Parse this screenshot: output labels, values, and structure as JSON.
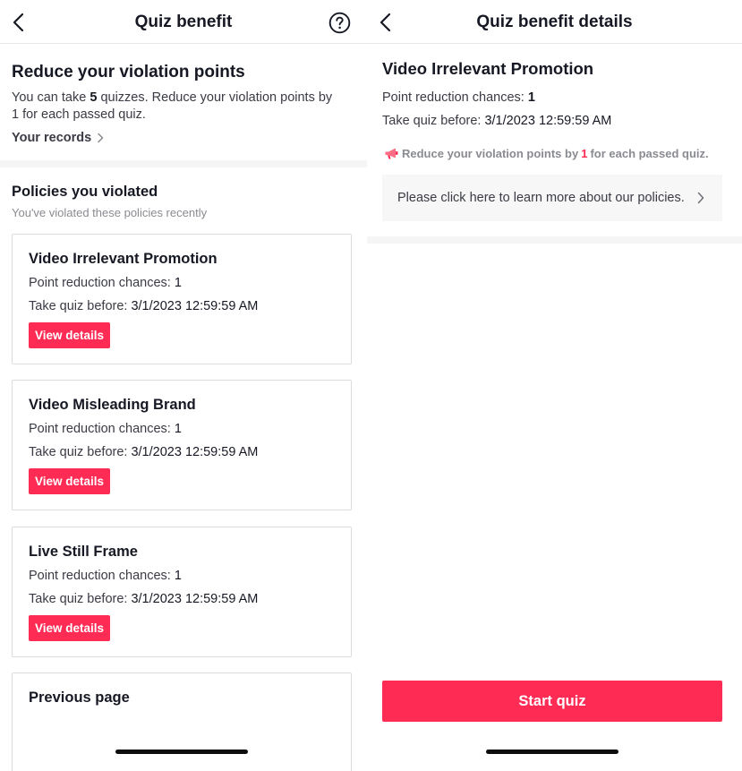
{
  "colors": {
    "accent": "#fe2c55",
    "text_primary": "#161823",
    "text_secondary": "#3a3b44",
    "text_muted": "#8a8b91"
  },
  "left": {
    "header": {
      "title": "Quiz benefit",
      "back_icon": "chevron-left-icon",
      "help_icon": "question-circle-icon"
    },
    "reduce": {
      "title": "Reduce your violation points",
      "desc_prefix": "You can take ",
      "quiz_count": "5",
      "desc_suffix": " quizzes. Reduce your violation points by 1 for each passed quiz.",
      "records_label": "Your records"
    },
    "policies": {
      "title": "Policies you violated",
      "subtitle": "You've violated these policies recently",
      "cards": [
        {
          "title": "Video Irrelevant Promotion",
          "chances_label": "Point reduction chances: ",
          "chances": "1",
          "deadline_label": "Take quiz before: ",
          "deadline": "3/1/2023 12:59:59 AM",
          "button": "View details"
        },
        {
          "title": "Video Misleading Brand",
          "chances_label": "Point reduction chances: ",
          "chances": "1",
          "deadline_label": "Take quiz before: ",
          "deadline": "3/1/2023 12:59:59 AM",
          "button": "View details"
        },
        {
          "title": "Live Still Frame",
          "chances_label": "Point reduction chances: ",
          "chances": "1",
          "deadline_label": "Take quiz before: ",
          "deadline": "3/1/2023 12:59:59 AM",
          "button": "View details"
        }
      ],
      "previous_page": "Previous page"
    }
  },
  "right": {
    "header": {
      "title": "Quiz benefit details",
      "back_icon": "chevron-left-icon"
    },
    "policy_title": "Video Irrelevant Promotion",
    "chances_label": "Point reduction chances: ",
    "chances": "1",
    "deadline_label": "Take quiz before: ",
    "deadline": "3/1/2023 12:59:59 AM",
    "notice_icon": "megaphone-icon",
    "notice_prefix": "Reduce your violation points by ",
    "notice_num": "1",
    "notice_suffix": " for each passed quiz.",
    "policy_link": "Please click here to learn more about our policies.",
    "start_button": "Start quiz"
  }
}
